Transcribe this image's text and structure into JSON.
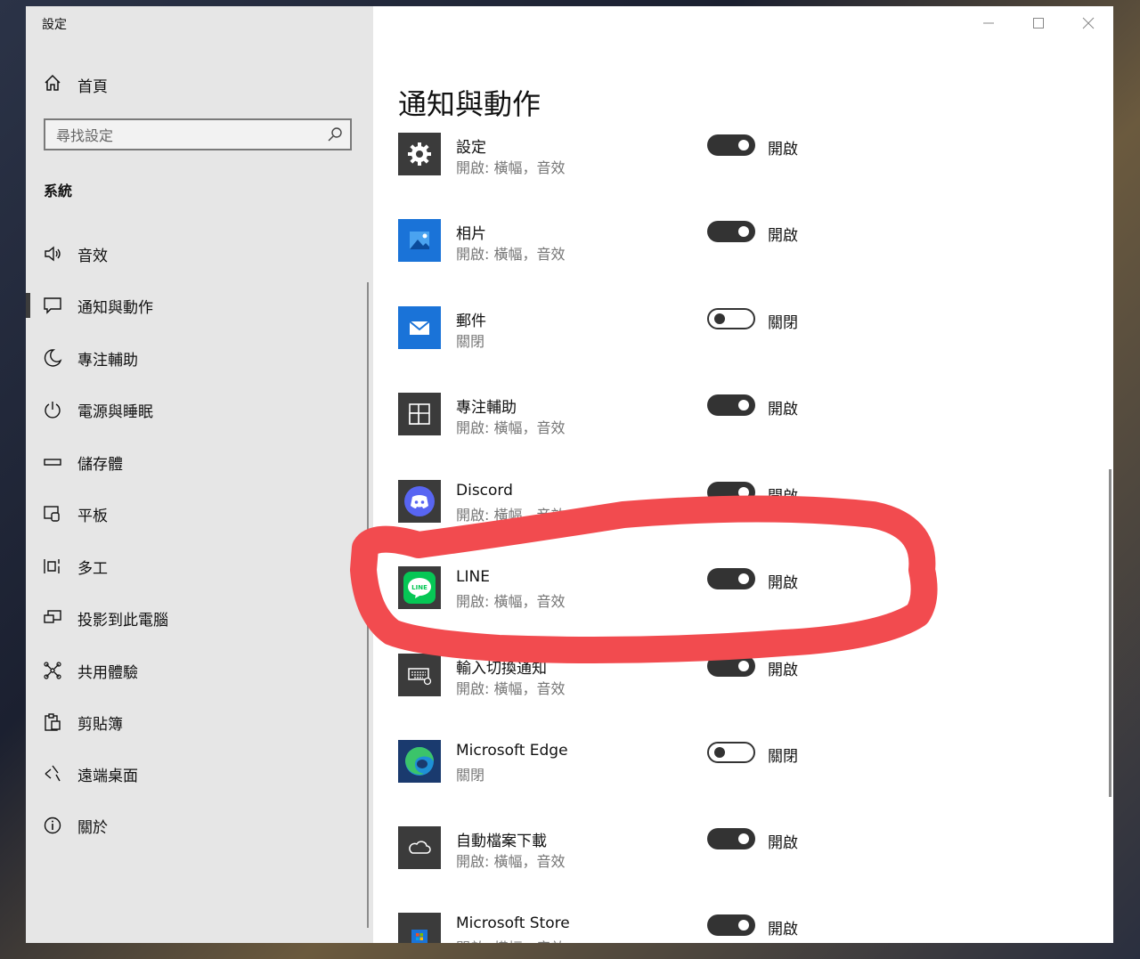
{
  "window": {
    "title": "設定"
  },
  "sidebar": {
    "home_label": "首頁",
    "search_placeholder": "尋找設定",
    "section": "系統",
    "items": [
      {
        "label": "音效",
        "icon": "speaker-icon"
      },
      {
        "label": "通知與動作",
        "icon": "message-icon",
        "active": true
      },
      {
        "label": "專注輔助",
        "icon": "moon-icon"
      },
      {
        "label": "電源與睡眠",
        "icon": "power-icon"
      },
      {
        "label": "儲存體",
        "icon": "storage-icon"
      },
      {
        "label": "平板",
        "icon": "tablet-icon"
      },
      {
        "label": "多工",
        "icon": "multitask-icon"
      },
      {
        "label": "投影到此電腦",
        "icon": "project-icon"
      },
      {
        "label": "共用體驗",
        "icon": "shared-icon"
      },
      {
        "label": "剪貼簿",
        "icon": "clipboard-icon"
      },
      {
        "label": "遠端桌面",
        "icon": "remote-icon"
      },
      {
        "label": "關於",
        "icon": "info-icon"
      }
    ]
  },
  "main": {
    "title": "通知與動作",
    "apps": [
      {
        "name": "設定",
        "sub": "開啟: 橫幅，音效",
        "state": "開啟",
        "on": true,
        "icon": "settings-gear-icon"
      },
      {
        "name": "相片",
        "sub": "開啟: 橫幅，音效",
        "state": "開啟",
        "on": true,
        "icon": "photos-icon"
      },
      {
        "name": "郵件",
        "sub": "關閉",
        "state": "關閉",
        "on": false,
        "icon": "mail-icon"
      },
      {
        "name": "專注輔助",
        "sub": "開啟: 橫幅，音效",
        "state": "開啟",
        "on": true,
        "icon": "focus-assist-icon"
      },
      {
        "name": "Discord",
        "sub": "開啟: 橫幅，音效",
        "state": "開啟",
        "on": true,
        "icon": "discord-icon"
      },
      {
        "name": "LINE",
        "sub": "開啟: 橫幅，音效",
        "state": "開啟",
        "on": true,
        "icon": "line-icon"
      },
      {
        "name": "輸入切換通知",
        "sub": "開啟: 橫幅，音效",
        "state": "開啟",
        "on": true,
        "icon": "keyboard-icon"
      },
      {
        "name": "Microsoft Edge",
        "sub": "關閉",
        "state": "關閉",
        "on": false,
        "icon": "edge-icon"
      },
      {
        "name": "自動檔案下載",
        "sub": "開啟: 橫幅，音效",
        "state": "開啟",
        "on": true,
        "icon": "cloud-icon"
      },
      {
        "name": "Microsoft Store",
        "sub": "開啟: 橫幅，音效",
        "state": "開啟",
        "on": true,
        "icon": "store-icon"
      }
    ]
  },
  "colors": {
    "annotation": "#f24b4f",
    "toggle_on": "#333333",
    "sidebar_bg": "#e6e6e6"
  }
}
